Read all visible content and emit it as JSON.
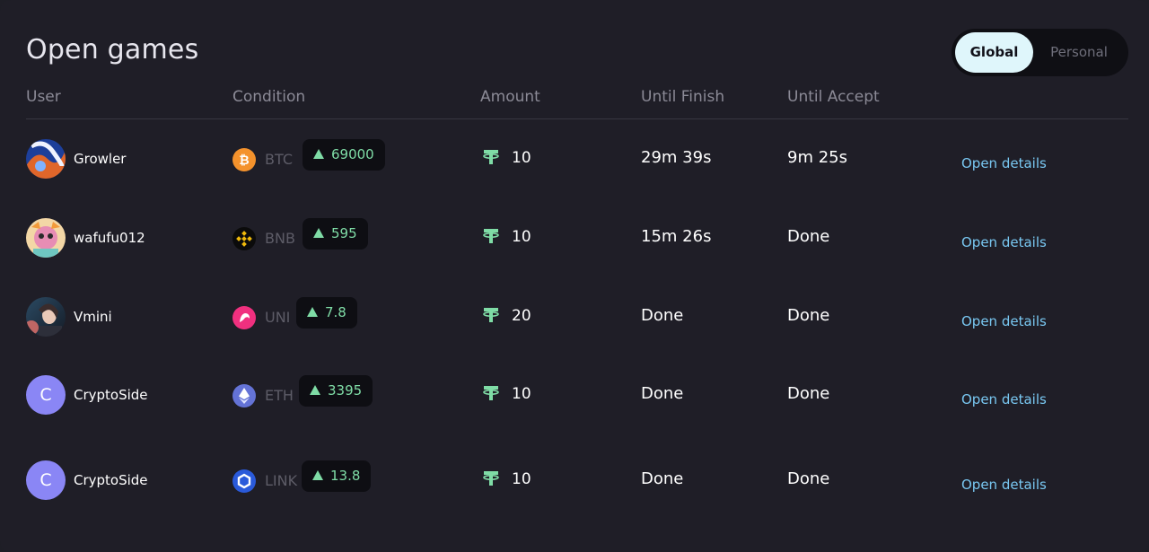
{
  "title": "Open games",
  "toggle": {
    "global": "Global",
    "personal": "Personal"
  },
  "headers": {
    "user": "User",
    "condition": "Condition",
    "amount": "Amount",
    "until_finish": "Until Finish",
    "until_accept": "Until Accept"
  },
  "colors": {
    "background": "#1f1e27",
    "accent_green": "#7fdca6",
    "link_blue": "#79c8f2",
    "toggle_active_bg": "#dff6fb",
    "avatar_letter_bg": "#8a86f5"
  },
  "rows": [
    {
      "user": "Growler",
      "avatar_icon": "growler-avatar",
      "coin": "BTC",
      "coin_icon": "bitcoin-icon",
      "condition_value": "69000",
      "condition_direction": "up",
      "amount": "10",
      "amount_icon": "tether-icon",
      "until_finish": "29m 39s",
      "until_accept": "9m 25s",
      "action": "Open details"
    },
    {
      "user": "wafufu012",
      "avatar_icon": "wafufu-avatar",
      "coin": "BNB",
      "coin_icon": "binance-icon",
      "condition_value": "595",
      "condition_direction": "up",
      "amount": "10",
      "amount_icon": "tether-icon",
      "until_finish": "15m 26s",
      "until_accept": "Done",
      "action": "Open details"
    },
    {
      "user": "Vmini",
      "avatar_icon": "vmini-avatar",
      "coin": "UNI",
      "coin_icon": "uniswap-icon",
      "condition_value": "7.8",
      "condition_direction": "up",
      "amount": "20",
      "amount_icon": "tether-icon",
      "until_finish": "Done",
      "until_accept": "Done",
      "action": "Open details"
    },
    {
      "user": "CryptoSide",
      "avatar_letter": "C",
      "coin": "ETH",
      "coin_icon": "ethereum-icon",
      "condition_value": "3395",
      "condition_direction": "up",
      "amount": "10",
      "amount_icon": "tether-icon",
      "until_finish": "Done",
      "until_accept": "Done",
      "action": "Open details"
    },
    {
      "user": "CryptoSide",
      "avatar_letter": "C",
      "coin": "LINK",
      "coin_icon": "chainlink-icon",
      "condition_value": "13.8",
      "condition_direction": "up",
      "amount": "10",
      "amount_icon": "tether-icon",
      "until_finish": "Done",
      "until_accept": "Done",
      "action": "Open details"
    }
  ]
}
